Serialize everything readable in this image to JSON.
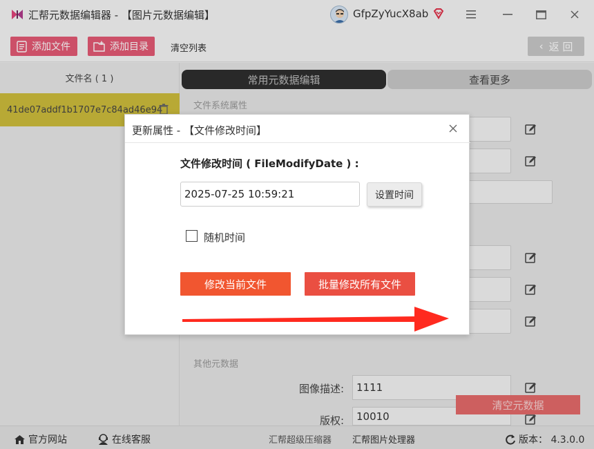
{
  "titlebar": {
    "app_title": "汇帮元数据编辑器 - 【图片元数据编辑】",
    "user_name": "GfpZyYucX8ab",
    "logo_icon": "butterfly-logo",
    "vip_icon": "diamond-icon",
    "menu_icon": "menu-icon",
    "minimize_icon": "minimize-icon",
    "maximize_icon": "maximize-icon",
    "close_icon": "close-icon"
  },
  "toolbar": {
    "add_file": "添加文件",
    "add_folder": "添加目录",
    "clear_list": "清空列表",
    "back": "返 回"
  },
  "file_list": {
    "header": "文件名 ( 1 )",
    "items": [
      {
        "name": "41de07addf1b1707e7c84ad46e94"
      }
    ]
  },
  "tabs": {
    "common": "常用元数据编辑",
    "more": "查看更多"
  },
  "sections": {
    "fs_props": "文件系统属性",
    "other_meta": "其他元数据"
  },
  "fields": [
    {
      "label": "图像描述:",
      "value": "1111"
    },
    {
      "label": "版权:",
      "value": "10010"
    }
  ],
  "clear_meta": "清空元数据",
  "statusbar": {
    "website": "官方网站",
    "service": "在线客服",
    "compressor": "汇帮超级压缩器",
    "image_tool": "汇帮图片处理器",
    "version": "版本： 4.3.0.0"
  },
  "dialog": {
    "title": "更新属性 - 【文件修改时间】",
    "field_label": "文件修改时间 ( FileModifyDate ) :",
    "datetime_value": "2025-07-25 10:59:21",
    "set_time": "设置时间",
    "random_time": "随机时间",
    "random_checked": false,
    "modify_current": "修改当前文件",
    "batch_modify": "批量修改所有文件"
  },
  "colors": {
    "toolbar_button": "#e45a74",
    "selected_row": "#cdbd3c",
    "orange_button": "#f15630",
    "red_button": "#ea4f42",
    "arrow": "#ff2a1f"
  }
}
